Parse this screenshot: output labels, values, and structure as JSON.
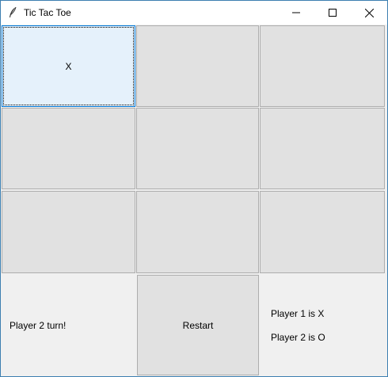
{
  "window": {
    "title": "Tic Tac Toe",
    "icon": "feather-icon",
    "controls": [
      "minimize-icon",
      "maximize-icon",
      "close-icon"
    ]
  },
  "board": {
    "cells": [
      "X",
      "",
      "",
      "",
      "",
      "",
      "",
      "",
      ""
    ],
    "focused_index": 0
  },
  "footer": {
    "status": "Player 2 turn!",
    "restart_label": "Restart",
    "player1_info": "Player 1 is X",
    "player2_info": "Player 2 is O"
  },
  "colors": {
    "cell_bg": "#e1e1e1",
    "focused_cell_bg": "#e5f1fb",
    "focus_border": "#0078d7",
    "window_border": "#3c7fb1"
  }
}
